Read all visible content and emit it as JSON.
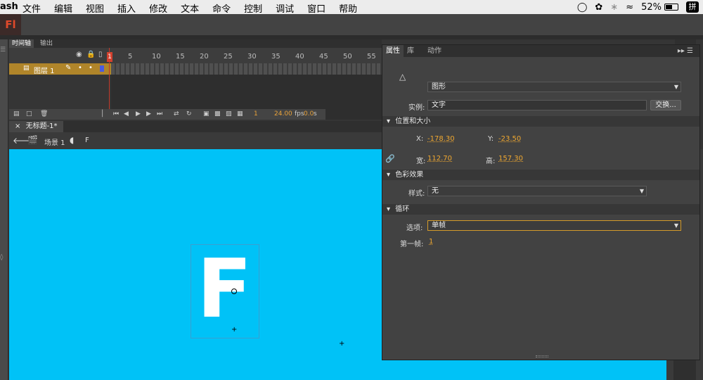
{
  "menubar": {
    "app_name": "ash",
    "menus": [
      "文件",
      "编辑",
      "视图",
      "插入",
      "修改",
      "文本",
      "命令",
      "控制",
      "调试",
      "窗口",
      "帮助"
    ],
    "battery": "52%",
    "ime": "拼"
  },
  "app": {
    "logo": "Fl"
  },
  "timeline": {
    "tabs": [
      "时间轴",
      "输出"
    ],
    "ruler": [
      "5",
      "10",
      "15",
      "20",
      "25",
      "30",
      "35",
      "40",
      "45",
      "50",
      "55"
    ],
    "playhead_frame": "1",
    "layer_name": "图层 1",
    "current_frame": "1",
    "fps": "24.00",
    "fps_unit": "fps",
    "elapsed": "0.0",
    "elapsed_unit": "s"
  },
  "document": {
    "tab_title": "无标题-1*",
    "scene": "场景 1",
    "symbol": "F"
  },
  "stage": {
    "background": "#00c2f7",
    "symbol_glyph": "F"
  },
  "properties": {
    "tabs": [
      "属性",
      "库",
      "动作"
    ],
    "type_select": "图形",
    "instance_label": "实例:",
    "instance_value": "文字",
    "swap_button": "交换...",
    "section_position": "位置和大小",
    "x_label": "X:",
    "x_value": "-178.30",
    "y_label": "Y:",
    "y_value": "-23.50",
    "w_label": "宽:",
    "w_value": "112.70",
    "h_label": "高:",
    "h_value": "157.30",
    "section_color": "色彩效果",
    "style_label": "样式:",
    "style_value": "无",
    "section_loop": "循环",
    "options_label": "选项:",
    "options_value": "单帧",
    "first_frame_label": "第一帧:",
    "first_frame_value": "1"
  }
}
